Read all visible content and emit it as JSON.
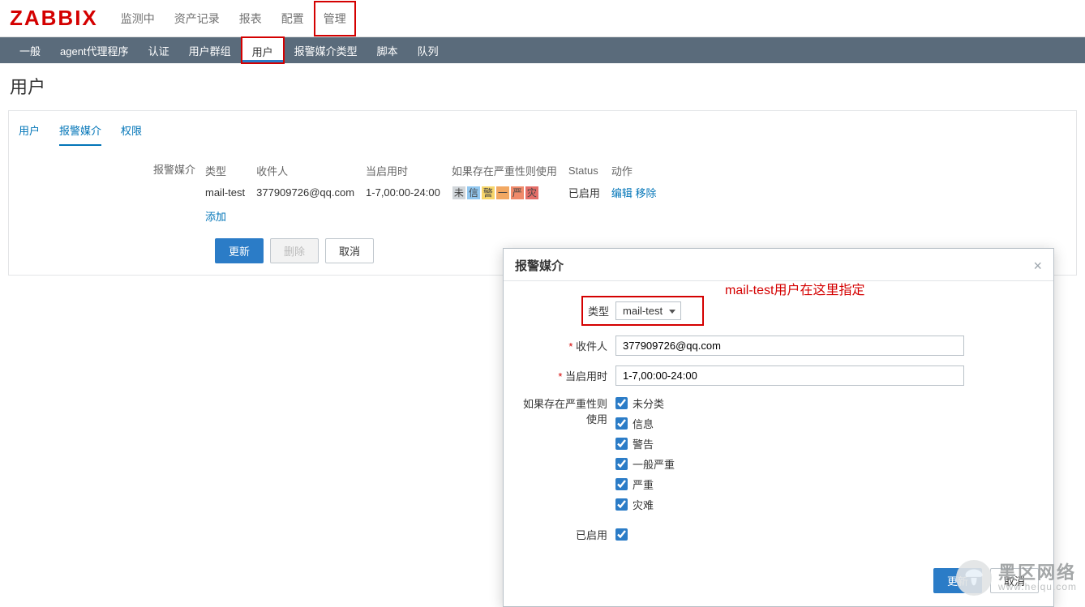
{
  "logo": "ZABBIX",
  "topnav": {
    "items": [
      "监测中",
      "资产记录",
      "报表",
      "配置",
      "管理"
    ],
    "highlight_index": 4
  },
  "subnav": {
    "items": [
      "一般",
      "agent代理程序",
      "认证",
      "用户群组",
      "用户",
      "报警媒介类型",
      "脚本",
      "队列"
    ],
    "active_index": 4,
    "highlight_index": 4
  },
  "page_title": "用户",
  "tabs": {
    "items": [
      "用户",
      "报警媒介",
      "权限"
    ],
    "current_index": 1
  },
  "media": {
    "label": "报警媒介",
    "headers": [
      "类型",
      "收件人",
      "当启用时",
      "如果存在严重性则使用",
      "Status",
      "动作"
    ],
    "row": {
      "type": "mail-test",
      "recipient": "377909726@qq.com",
      "when": "1-7,00:00-24:00",
      "severity_chars": [
        "未",
        "信",
        "警",
        "一",
        "严",
        "灾"
      ],
      "status": "已启用",
      "actions": [
        "编辑",
        "移除"
      ]
    },
    "add_label": "添加"
  },
  "buttons": {
    "update": "更新",
    "delete": "删除",
    "cancel": "取消"
  },
  "modal": {
    "title": "报警媒介",
    "type_label": "类型",
    "type_value": "mail-test",
    "recipient_label": "收件人",
    "recipient_value": "377909726@qq.com",
    "when_label": "当启用时",
    "when_value": "1-7,00:00-24:00",
    "severity_label": "如果存在严重性则使用",
    "severity_options": [
      "未分类",
      "信息",
      "警告",
      "一般严重",
      "严重",
      "灾难"
    ],
    "enabled_label": "已启用",
    "update": "更新",
    "cancel": "取消"
  },
  "annotation": "mail-test用户在这里指定",
  "watermark": {
    "t1": "黑区网络",
    "t2": "www.heiqu.com"
  }
}
